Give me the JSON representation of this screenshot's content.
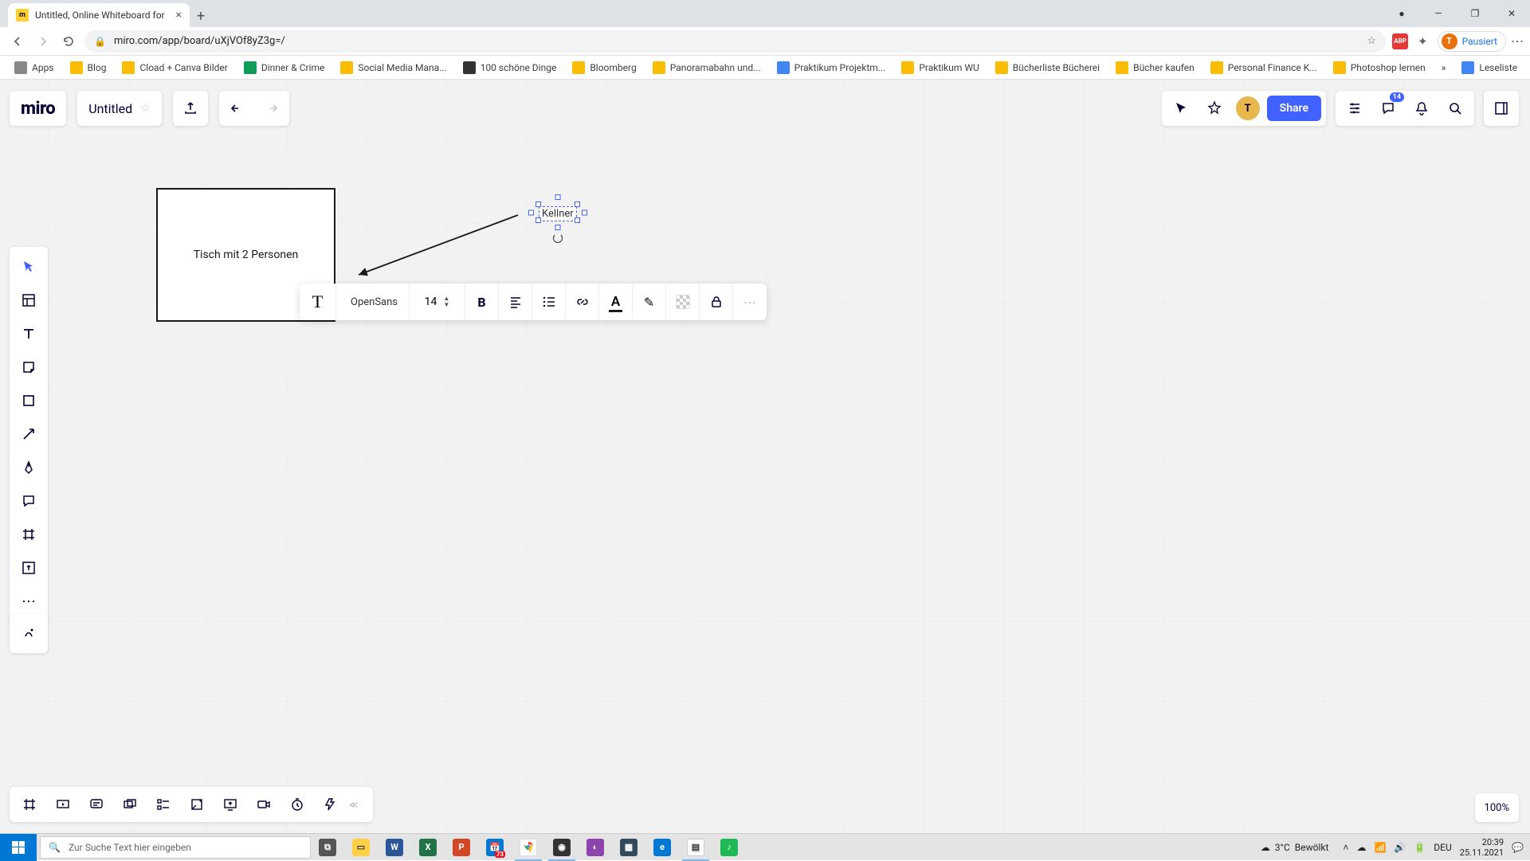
{
  "browser": {
    "tab_title": "Untitled, Online Whiteboard for",
    "url": "miro.com/app/board/uXjVOf8yZ3g=/",
    "profile_status": "Pausiert",
    "profile_initial": "T",
    "bookmarks": [
      {
        "label": "Apps",
        "icon": "grid"
      },
      {
        "label": "Blog",
        "icon": "y"
      },
      {
        "label": "Cload + Canva Bilder",
        "icon": "y"
      },
      {
        "label": "Dinner & Crime",
        "icon": "g"
      },
      {
        "label": "Social Media Mana...",
        "icon": "y"
      },
      {
        "label": "100 schöne Dinge",
        "icon": "d"
      },
      {
        "label": "Bloomberg",
        "icon": "y"
      },
      {
        "label": "Panoramabahn und...",
        "icon": "y"
      },
      {
        "label": "Praktikum Projektm...",
        "icon": "b"
      },
      {
        "label": "Praktikum WU",
        "icon": "y"
      },
      {
        "label": "Bücherliste Bücherei",
        "icon": "y"
      },
      {
        "label": "Bücher kaufen",
        "icon": "y"
      },
      {
        "label": "Personal Finance K...",
        "icon": "y"
      },
      {
        "label": "Photoshop lernen",
        "icon": "y"
      }
    ],
    "reading_list": "Leseliste"
  },
  "miro": {
    "logo": "miro",
    "board_title": "Untitled",
    "share_label": "Share",
    "avatar_initial": "T",
    "notification_count": "14",
    "zoom": "100%",
    "canvas": {
      "rect_text": "Tisch mit 2 Personen",
      "selected_text": "Kellner"
    },
    "format_bar": {
      "font": "OpenSans",
      "size": "14"
    }
  },
  "taskbar": {
    "search_placeholder": "Zur Suche Text hier eingeben",
    "weather_temp": "3°C",
    "weather_desc": "Bewölkt",
    "lang": "DEU",
    "time": "20:39",
    "date": "25.11.2021",
    "calendar_badge": "73"
  }
}
